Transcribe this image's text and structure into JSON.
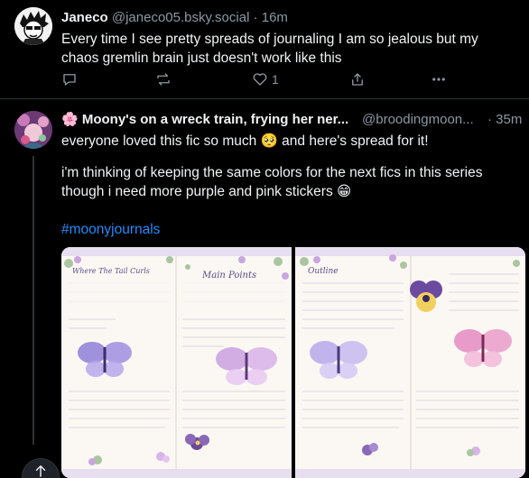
{
  "post1": {
    "author_name": "Janeco",
    "handle": "@janeco05.bsky.social",
    "separator": "·",
    "time": "16m",
    "text": "Every time I see pretty spreads of journaling I am so jealous but my chaos gremlin brain just doesn't work like this",
    "like_count": "1"
  },
  "post2": {
    "author_emoji": "🌸",
    "author_name": "Moony's on a wreck train, frying her ner...",
    "handle": "@broodingmoon...",
    "separator": "·",
    "time": "35m",
    "text_line1": "everyone loved this fic so much 🥺 and here's spread for it!",
    "text_line2": "i'm thinking of keeping the same colors for the next fics in this series though i need more purple and pink stickers 😁",
    "hashtag": "#moonyjournals",
    "image_left": {
      "title_left": "Where The Tail Curls",
      "title_right": "Main Points"
    },
    "image_right": {
      "title_left": "Outline"
    }
  },
  "colors": {
    "background": "#000000",
    "text": "#f1f3f5",
    "muted": "#8b98a5",
    "link": "#208bfe",
    "divider": "#2f3336"
  },
  "icons": {
    "reply": "reply-icon",
    "repost": "repost-icon",
    "like": "like-icon",
    "share": "share-icon",
    "more": "more-icon",
    "scroll_top": "arrow-up-icon"
  }
}
